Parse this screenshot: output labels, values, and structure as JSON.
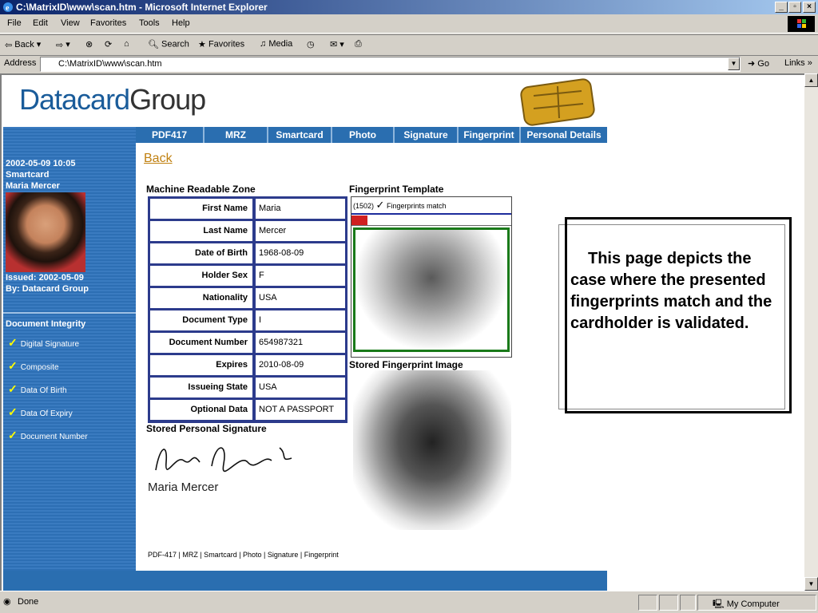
{
  "window": {
    "title": "C:\\MatrixID\\www\\scan.htm - Microsoft Internet Explorer"
  },
  "menu": [
    "File",
    "Edit",
    "View",
    "Favorites",
    "Tools",
    "Help"
  ],
  "toolbar": {
    "back": "Back",
    "search": "Search",
    "favorites": "Favorites",
    "media": "Media"
  },
  "address": {
    "label": "Address",
    "value": "C:\\MatrixID\\www\\scan.htm",
    "go": "Go",
    "links": "Links"
  },
  "page": {
    "logo_main": "Datacard",
    "logo_group": "Group",
    "nav": [
      "PDF417",
      "MRZ",
      "Smartcard",
      "Photo",
      "Signature",
      "Fingerprint",
      "Personal Details"
    ],
    "sidebar": {
      "datetime": "2002-05-09 10:05",
      "type": "Smartcard",
      "name": "Maria Mercer",
      "issued": "Issued: 2002-05-09",
      "by": "By: Datacard Group",
      "integrity_title": "Document Integrity",
      "integrity_items": [
        "Digital Signature",
        "Composite",
        "Data Of Birth",
        "Data Of Expiry",
        "Document Number"
      ]
    },
    "back": "Back",
    "mrz_title": "Machine Readable Zone",
    "mrz": [
      {
        "label": "First Name",
        "value": "Maria"
      },
      {
        "label": "Last Name",
        "value": "Mercer"
      },
      {
        "label": "Date of Birth",
        "value": "1968-08-09"
      },
      {
        "label": "Holder Sex",
        "value": "F"
      },
      {
        "label": "Nationality",
        "value": "USA"
      },
      {
        "label": "Document Type",
        "value": "I"
      },
      {
        "label": "Document Number",
        "value": "654987321"
      },
      {
        "label": "Expires",
        "value": "2010-08-09"
      },
      {
        "label": "Issueing State",
        "value": "USA"
      },
      {
        "label": "Optional Data",
        "value": "NOT A PASSPORT"
      }
    ],
    "signature_title": "Stored Personal Signature",
    "signature_name": "Maria Mercer",
    "fp_template_title": "Fingerprint Template",
    "fp_score": "(1502)",
    "fp_match": "Fingerprints match",
    "fp_stored_title": "Stored Fingerprint Image",
    "footer": "PDF-417  |  MRZ  |  Smartcard  |  Photo  |  Signature  |  Fingerprint",
    "note": "This page depicts the case where the presented fingerprints match and the cardholder is validated."
  },
  "status": {
    "text": "Done",
    "zone": "My Computer"
  },
  "colors": {
    "nav": "#2a6eb0",
    "mrz_border": "#2c3b8c",
    "check": "#ffff00"
  }
}
